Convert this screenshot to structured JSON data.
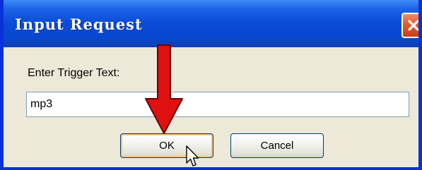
{
  "window": {
    "title": "Input Request",
    "close_icon": "close-x-icon"
  },
  "dialog": {
    "prompt_label": "Enter Trigger Text:",
    "input_value": "mp3",
    "ok_label": "OK",
    "cancel_label": "Cancel"
  },
  "annotation": {
    "arrow_icon": "red-down-arrow-icon",
    "arrow_color": "#e01010",
    "cursor_icon": "mouse-pointer-icon"
  },
  "colors": {
    "titlebar": "#0a4ad6",
    "close_button": "#e2572c",
    "dialog_background": "#ece9d8"
  }
}
